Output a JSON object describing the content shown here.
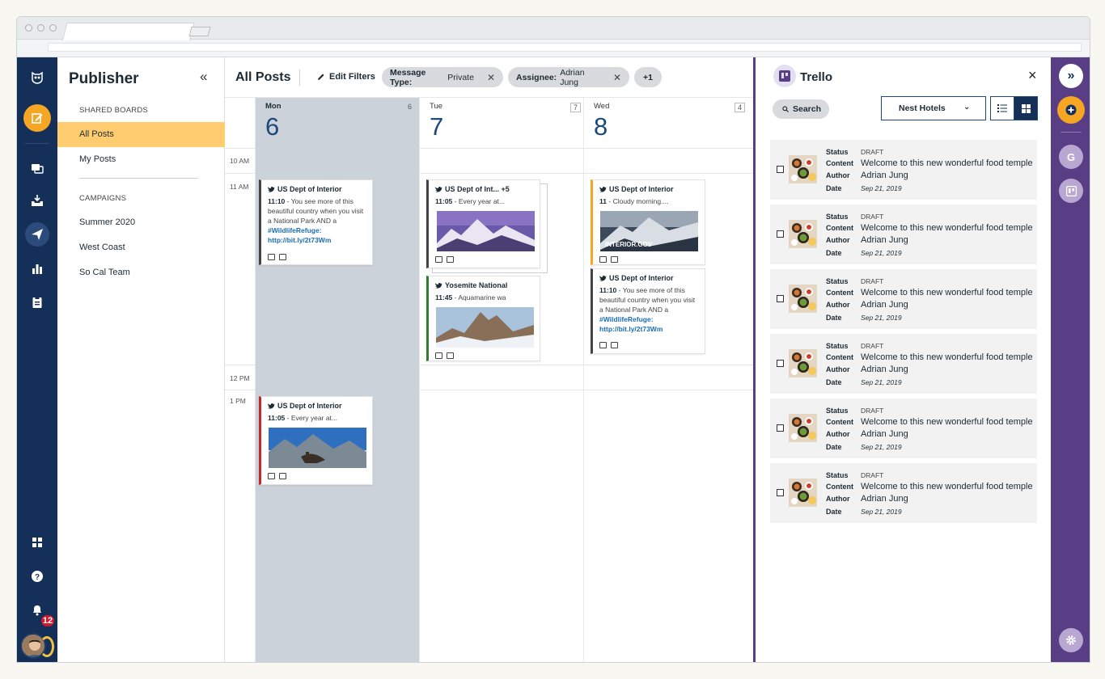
{
  "browser": {
    "window_controls": [
      "close",
      "minimize",
      "maximize"
    ]
  },
  "rail": {
    "notification_count": "12",
    "icons": [
      "owl-logo-icon",
      "compose-icon",
      "streams-icon",
      "inbox-icon",
      "publisher-icon",
      "analytics-icon",
      "assignments-icon",
      "apps-icon",
      "help-icon",
      "bell-icon"
    ]
  },
  "publisher": {
    "title": "Publisher",
    "collapse": "«",
    "shared_boards_label": "SHARED BOARDS",
    "shared_boards": [
      "All Posts",
      "My Posts"
    ],
    "campaigns_label": "CAMPAIGNS",
    "campaigns": [
      "Summer 2020",
      "West Coast",
      "So Cal Team"
    ]
  },
  "toolbar": {
    "title": "All Posts",
    "edit_filters": "Edit Filters",
    "chips": [
      {
        "key": "Message Type:",
        "value": "Private"
      },
      {
        "key": "Assignee:",
        "value": "Adrian Jung"
      }
    ],
    "more_chip": "+1"
  },
  "calendar": {
    "times": [
      "10 AM",
      "11 AM",
      "12 PM",
      "1 PM"
    ],
    "days": [
      {
        "name": "Mon",
        "num": "6",
        "count": "6"
      },
      {
        "name": "Tue",
        "num": "7",
        "count": "7"
      },
      {
        "name": "Wed",
        "num": "8",
        "count": "4"
      }
    ],
    "posts": {
      "mon1": {
        "author": "US Dept of Interior",
        "time": "11:10",
        "text": "You see more of this beautiful country when you visit a National Park AND a",
        "hashtag": "#WildlifeRefuge",
        "link": "http://bit.ly/2t73Wm"
      },
      "mon2": {
        "author": "US Dept of Interior",
        "time": "11:05",
        "text": "Every year at..."
      },
      "tue1": {
        "author": "US Dept of Int... +5",
        "time": "11:05",
        "text": "Every year at..."
      },
      "tue2": {
        "author": "Yosemite National",
        "time": "11:45",
        "text": "Aquamarine wa"
      },
      "wed1": {
        "author": "US Dept of Interior",
        "time": "11",
        "text": "Cloudy morning....",
        "image_caption": "INTERIOR.GOV"
      },
      "wed2": {
        "author": "US Dept of Interior",
        "time": "11:10",
        "text": "You see more of this beautiful country when you visit a National Park AND a",
        "hashtag": "#WildlifeRefuge",
        "link": "http://bit.ly/2t73Wm"
      }
    },
    "colors": {
      "today_bg": "#cbd2da",
      "mon1": "#444444",
      "mon2": "#c62828",
      "tue1": "#444444",
      "tue2": "#2e7d32",
      "wed1": "#f5a623",
      "wed2": "#444444"
    }
  },
  "trello": {
    "title": "Trello",
    "close": "×",
    "search": "Search",
    "board": "Nest Hotels",
    "labels": {
      "status": "Status",
      "content": "Content",
      "author": "Author",
      "date": "Date"
    },
    "cards": [
      {
        "status": "DRAFT",
        "content": "Welcome to this new wonderful food temple",
        "author": "Adrian Jung",
        "date": "Sep 21, 2019"
      },
      {
        "status": "DRAFT",
        "content": "Welcome to this new wonderful food temple",
        "author": "Adrian Jung",
        "date": "Sep 21, 2019"
      },
      {
        "status": "DRAFT",
        "content": "Welcome to this new wonderful food temple",
        "author": "Adrian Jung",
        "date": "Sep 21, 2019"
      },
      {
        "status": "DRAFT",
        "content": "Welcome to this new wonderful food temple",
        "author": "Adrian Jung",
        "date": "Sep 21, 2019"
      },
      {
        "status": "DRAFT",
        "content": "Welcome to this new wonderful food temple",
        "author": "Adrian Jung",
        "date": "Sep 21, 2019"
      },
      {
        "status": "DRAFT",
        "content": "Welcome to this new wonderful food temple",
        "author": "Adrian Jung",
        "date": "Sep 21, 2019"
      }
    ]
  },
  "right_rail": {
    "expand": "»",
    "google_letter": "G"
  },
  "theme": {
    "navy": "#143059",
    "purple": "#593d85",
    "orange": "#f5a623",
    "highlight": "#ffcd70"
  }
}
